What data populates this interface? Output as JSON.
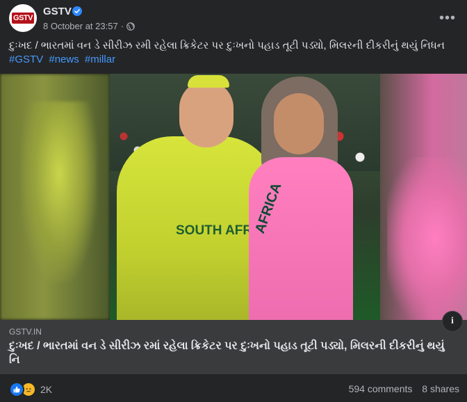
{
  "post": {
    "page_name": "GSTV",
    "avatar_text": "GSTV",
    "timestamp": "8 October at 23:57",
    "separator": "·",
    "caption": "દુઃખદ / ભારતમાં વન ડે સીરીઝ રમી રહેલા ક્રિકેટર પર દુઃખનો પહાડ તૂટી પડ્યો, મિલરની દીકરીનું થયું નિધન",
    "hashtags": [
      "#GSTV",
      "#news",
      "#millar"
    ],
    "more_label": "•••"
  },
  "media": {
    "jersey_text_left": "SOUTH AFRICA",
    "jersey_text_right": "AFRICA"
  },
  "link": {
    "domain": "GSTV.IN",
    "title": "દુઃખદ / ભારતમાં વન ડે સીરીઝ રમાં રહેલા ક્રિકેટર પર દુઃખનો પહાડ તૂટી પડ્યો, મિલરની દીકરીનું થયું નિ",
    "info_label": "i"
  },
  "footer": {
    "reaction_count": "2K",
    "comments": "594 comments",
    "shares": "8 shares"
  },
  "colors": {
    "background": "#242526",
    "link_box": "#3a3b3c",
    "hashtag": "#4599ff",
    "like": "#1877f2",
    "sad": "#f7b928"
  },
  "icons": {
    "verified": "verified-badge-icon",
    "audience": "globe-icon",
    "more": "more-options-icon",
    "info": "info-icon",
    "like": "like-reaction-icon",
    "sad": "sad-reaction-icon"
  }
}
